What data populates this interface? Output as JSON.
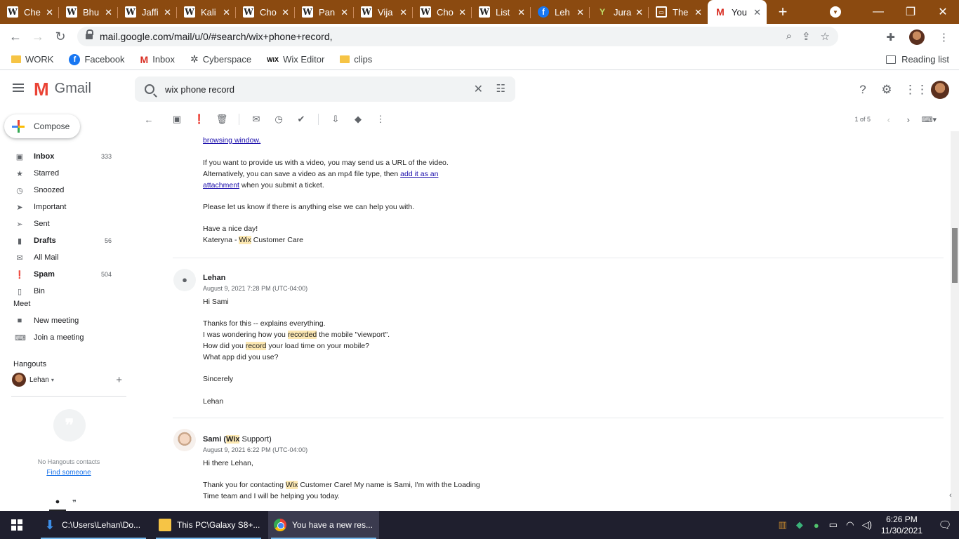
{
  "browser": {
    "tabs": [
      {
        "title": "Che",
        "icon": "wikipedia-icon"
      },
      {
        "title": "Bhu",
        "icon": "wikipedia-icon"
      },
      {
        "title": "Jaffi",
        "icon": "wikipedia-icon"
      },
      {
        "title": "Kali",
        "icon": "wikipedia-icon"
      },
      {
        "title": "Cho",
        "icon": "wikipedia-icon"
      },
      {
        "title": "Pan",
        "icon": "wikipedia-icon"
      },
      {
        "title": "Vija",
        "icon": "wikipedia-icon"
      },
      {
        "title": "Cho",
        "icon": "wikipedia-icon"
      },
      {
        "title": "List",
        "icon": "wikipedia-icon"
      },
      {
        "title": "Leh",
        "icon": "facebook-icon"
      },
      {
        "title": "Jura",
        "icon": "yoast-icon"
      },
      {
        "title": "The",
        "icon": "monitor-icon"
      },
      {
        "title": "You",
        "icon": "gmail-icon",
        "active": true
      }
    ],
    "url": "mail.google.com/mail/u/0/#search/wix+phone+record,",
    "bookmarks": [
      {
        "label": "WORK",
        "icon": "folder-icon"
      },
      {
        "label": "Facebook",
        "icon": "facebook-icon"
      },
      {
        "label": "Inbox",
        "icon": "gmail-icon"
      },
      {
        "label": "Cyberspace",
        "icon": "cyberspace-icon"
      },
      {
        "label": "Wix Editor",
        "icon": "wix-icon"
      },
      {
        "label": "clips",
        "icon": "folder-icon"
      }
    ],
    "reading_list": "Reading list"
  },
  "gmail": {
    "product_name": "Gmail",
    "search_query": "wix phone record",
    "compose_label": "Compose",
    "nav": [
      {
        "label": "Inbox",
        "count": "333",
        "bold": true,
        "icon": "inbox-icon"
      },
      {
        "label": "Starred",
        "count": "",
        "bold": false,
        "icon": "star-icon"
      },
      {
        "label": "Snoozed",
        "count": "",
        "bold": false,
        "icon": "clock-icon"
      },
      {
        "label": "Important",
        "count": "",
        "bold": false,
        "icon": "important-icon"
      },
      {
        "label": "Sent",
        "count": "",
        "bold": false,
        "icon": "send-icon"
      },
      {
        "label": "Drafts",
        "count": "56",
        "bold": true,
        "icon": "draft-icon"
      },
      {
        "label": "All Mail",
        "count": "",
        "bold": false,
        "icon": "mail-icon"
      },
      {
        "label": "Spam",
        "count": "504",
        "bold": true,
        "icon": "spam-icon"
      },
      {
        "label": "Bin",
        "count": "",
        "bold": false,
        "icon": "bin-icon"
      }
    ],
    "meet": {
      "heading": "Meet",
      "new_meeting": "New meeting",
      "join_meeting": "Join a meeting"
    },
    "hangouts": {
      "heading": "Hangouts",
      "user": "Lehan",
      "no_contacts": "No Hangouts contacts",
      "find_someone": "Find someone"
    },
    "pager": "1 of 5"
  },
  "thread": {
    "msg1_tail": {
      "line_top": "browsing window.",
      "p1_l1": "If you want to provide us with a video, you may send us a URL of the video.",
      "p1_l2_pre": "Alternatively, you can save a video as an mp4 file type, then ",
      "p1_link1": "add it as an",
      "p1_link2": "attachment",
      "p1_l3_post": " when you submit a ticket.",
      "p2": "Please let us know if there is anything else we can help you with.",
      "p3": "Have a nice day!",
      "sig_pre": "Kateryna - ",
      "sig_hl": "Wix",
      "sig_post": " Customer Care"
    },
    "msg2": {
      "sender": "Lehan",
      "date": "August 9, 2021 7:28 PM (UTC-04:00)",
      "greeting": "Hi Sami",
      "l1": "Thanks for this -- explains everything.",
      "l2_pre": "I was wondering how you ",
      "l2_hl": "recorded",
      "l2_post": " the mobile \"viewport\".",
      "l3_pre": "How did you ",
      "l3_hl": "record",
      "l3_post": " your load time on your mobile?",
      "l4": "What app did you use?",
      "closing": "Sincerely",
      "name": "Lehan"
    },
    "msg3": {
      "sender_pre": "Sami (",
      "sender_hl": "Wix",
      "sender_post": " Support)",
      "date": "August 9, 2021 6:22 PM (UTC-04:00)",
      "greeting": "Hi there Lehan,",
      "l1_pre": "Thank you for contacting ",
      "l1_hl": "Wix",
      "l1_post": " Customer Care! My name is Sami, I'm with the Loading",
      "l2": "Time team and I will be helping you today."
    }
  },
  "taskbar": {
    "items": [
      {
        "label": "C:\\Users\\Lehan\\Do...",
        "icon": "download-folder-icon"
      },
      {
        "label": "This PC\\Galaxy S8+...",
        "icon": "folder-icon"
      },
      {
        "label": "You have a new res...",
        "icon": "chrome-icon"
      }
    ],
    "time": "6:26 PM",
    "date": "11/30/2021"
  }
}
